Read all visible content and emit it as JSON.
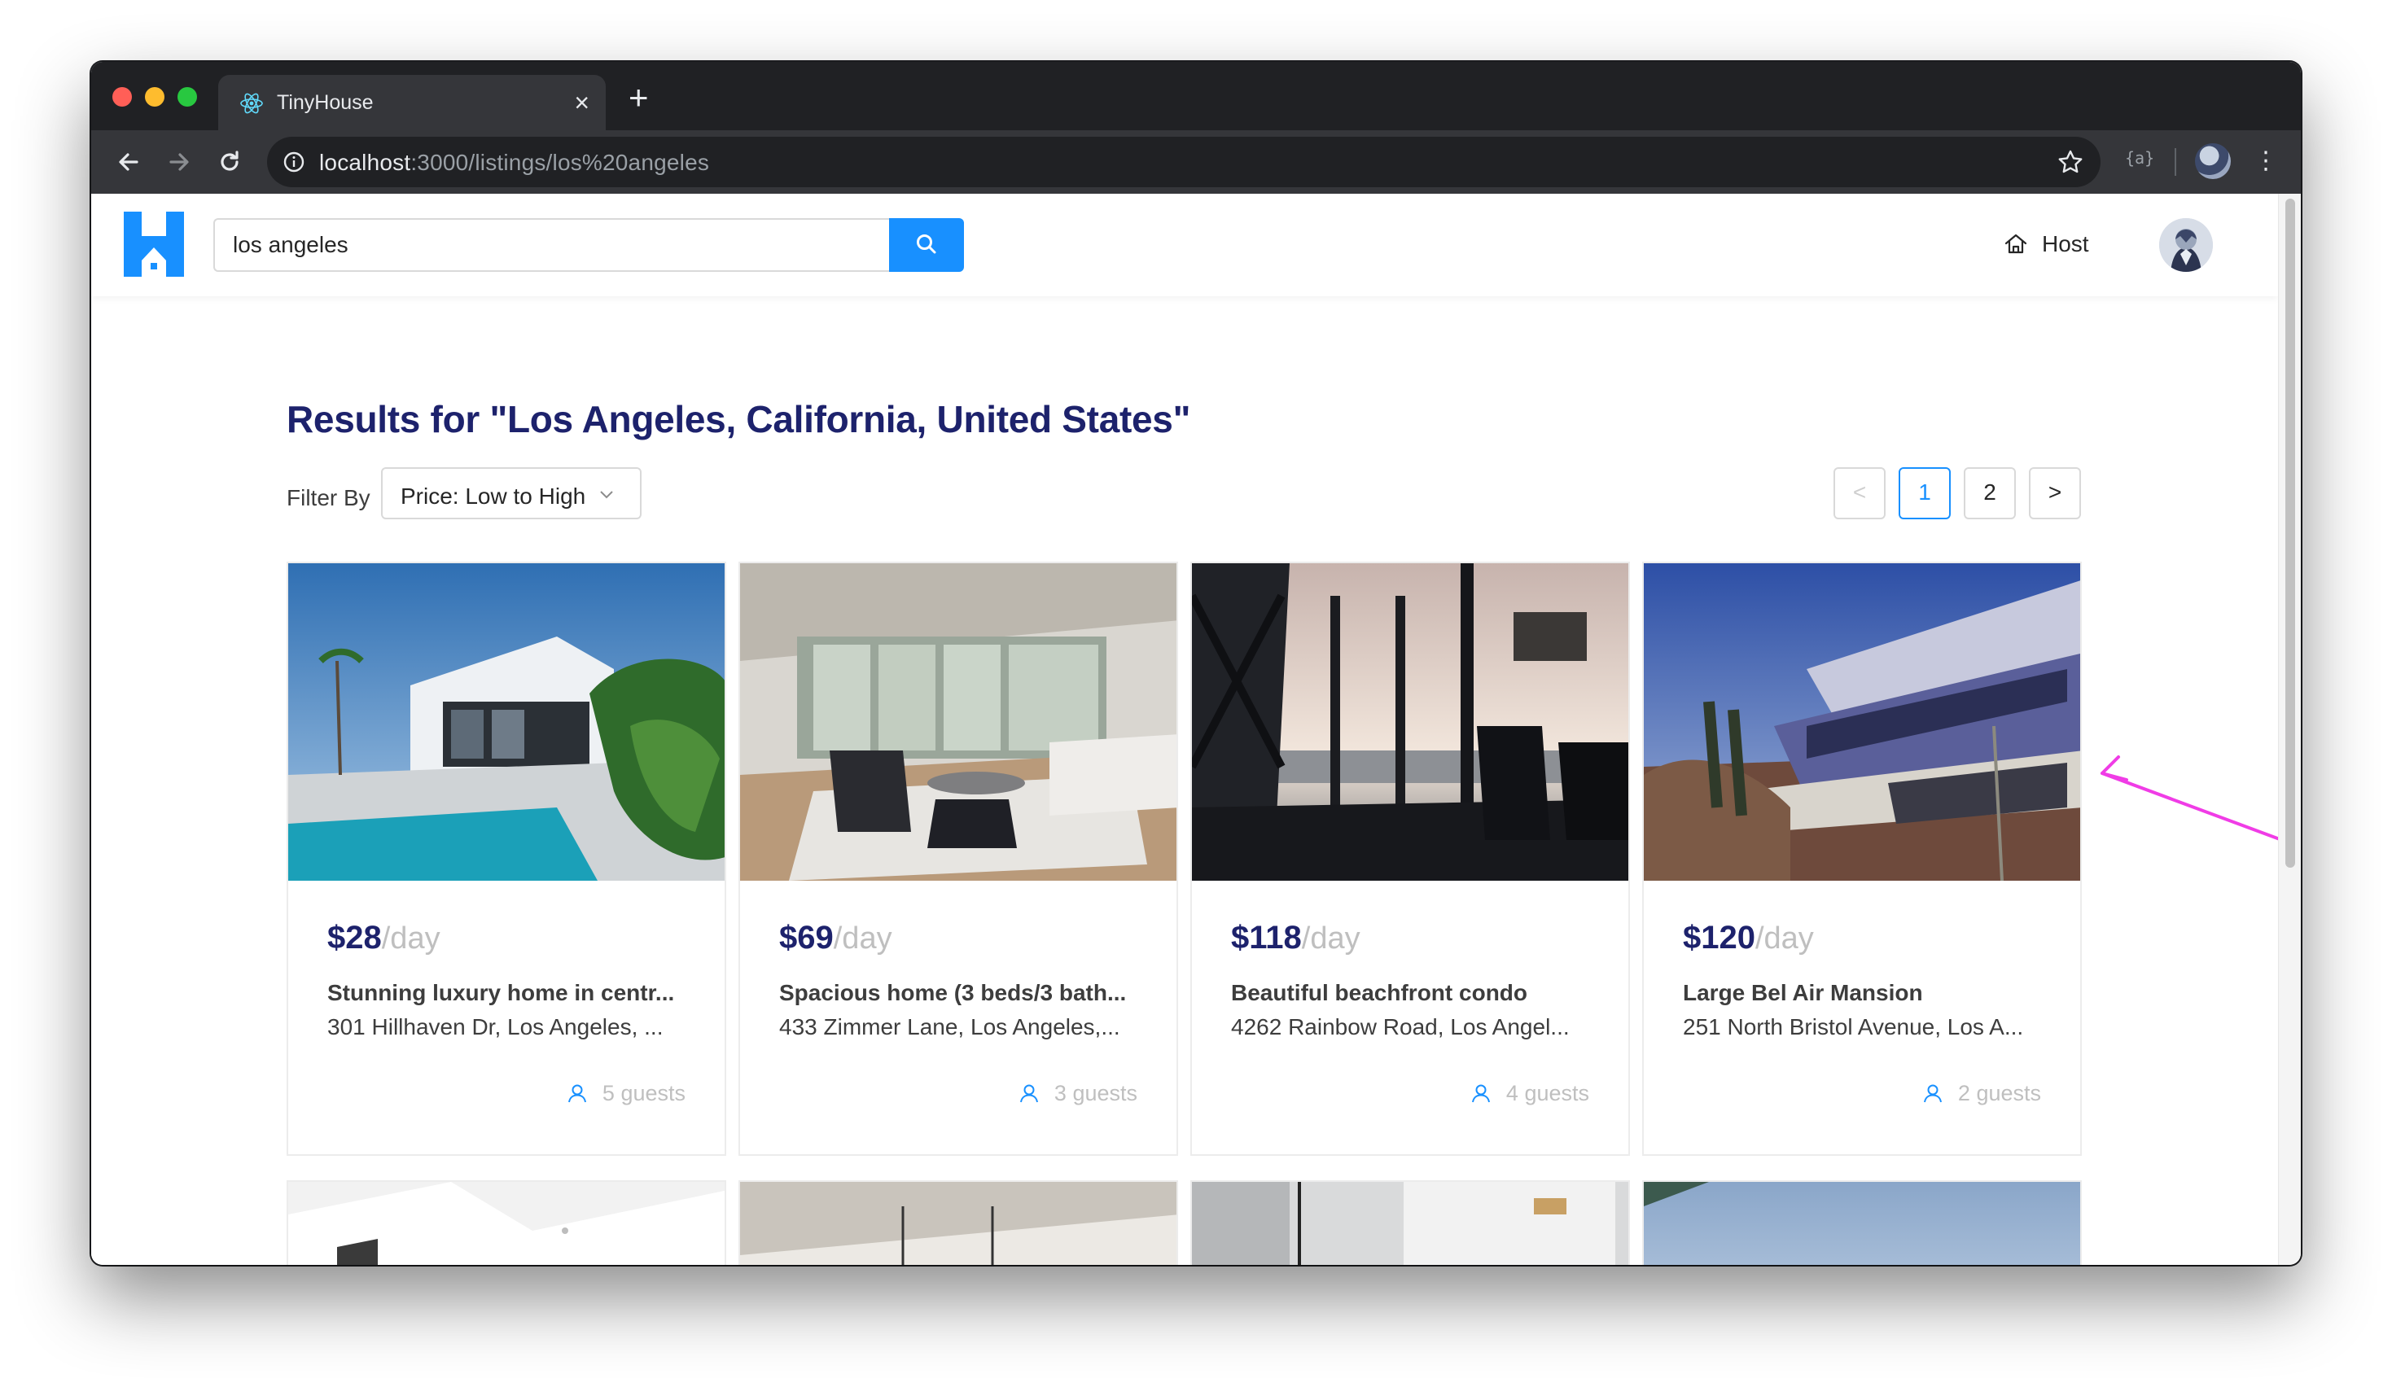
{
  "browser": {
    "tab_title": "TinyHouse",
    "url_host": "localhost",
    "url_path": ":3000/listings/los%20angeles",
    "tab_close": "×",
    "new_tab": "+",
    "menu": "⋮",
    "extension": "{a}"
  },
  "header": {
    "search_value": "los angeles",
    "host_label": "Host"
  },
  "results": {
    "title": "Results for \"Los Angeles, California, United States\"",
    "filter_label": "Filter By",
    "filter_value": "Price: Low to High"
  },
  "pagination": {
    "prev": "<",
    "pages": [
      "1",
      "2"
    ],
    "next": ">",
    "current": "1"
  },
  "listings": [
    {
      "price": "$28",
      "per": "/day",
      "title": "Stunning luxury home in centr...",
      "address": "301 Hillhaven Dr, Los Angeles, ...",
      "guests": "5 guests"
    },
    {
      "price": "$69",
      "per": "/day",
      "title": "Spacious home (3 beds/3 bath...",
      "address": "433 Zimmer Lane, Los Angeles,...",
      "guests": "3 guests"
    },
    {
      "price": "$118",
      "per": "/day",
      "title": "Beautiful beachfront condo",
      "address": "4262 Rainbow Road, Los Angel...",
      "guests": "4 guests"
    },
    {
      "price": "$120",
      "per": "/day",
      "title": "Large Bel Air Mansion",
      "address": "251 North Bristol Avenue, Los A...",
      "guests": "2 guests"
    }
  ],
  "colors": {
    "brand_blue": "#1890ff",
    "title_navy": "#1d226c",
    "annotation_arrow": "#f03ce6"
  }
}
